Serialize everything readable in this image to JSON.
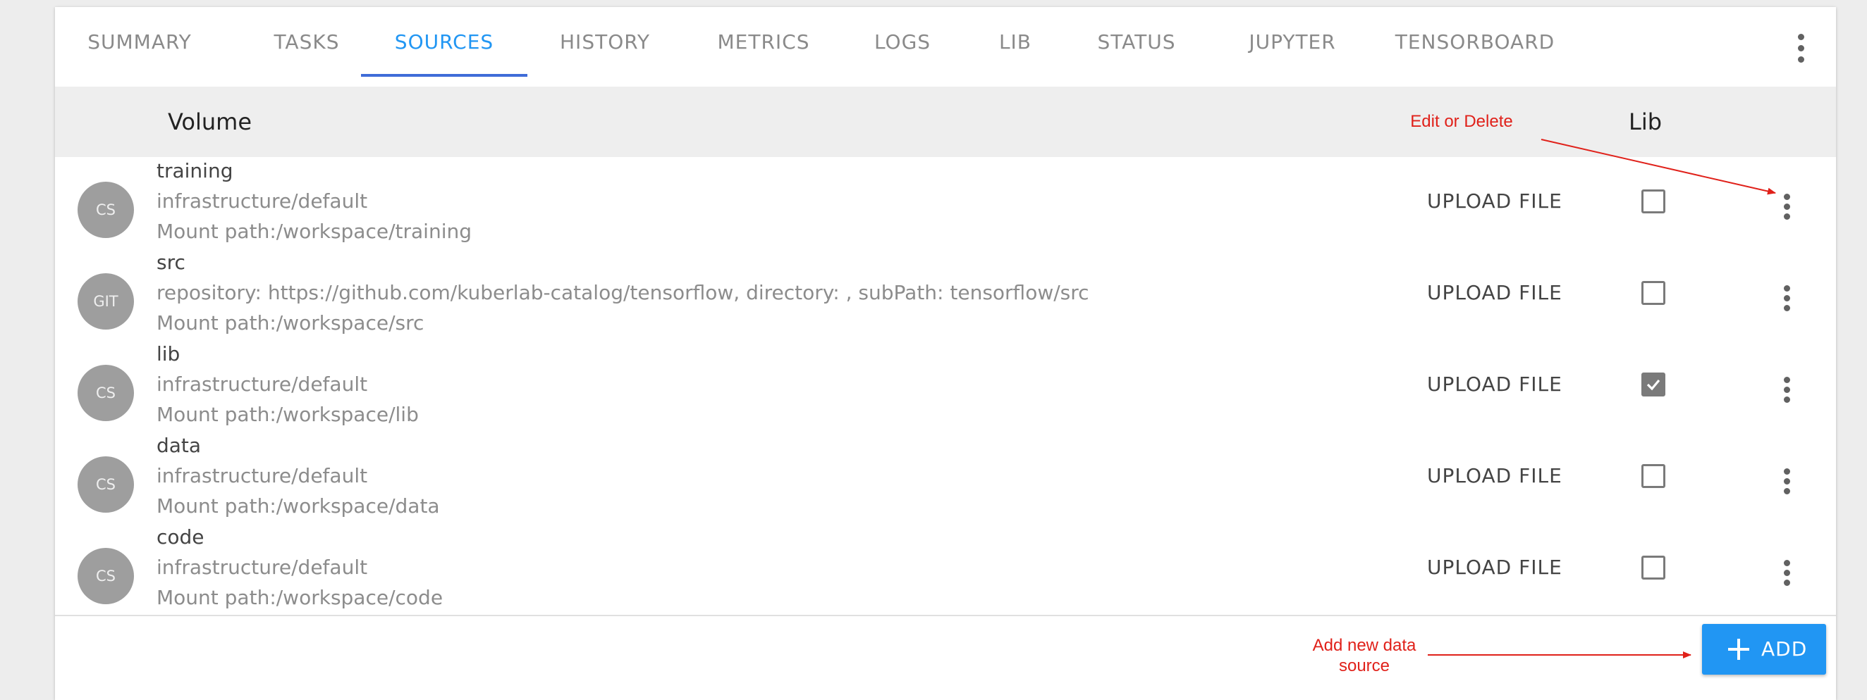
{
  "tabs": [
    {
      "label": "SUMMARY"
    },
    {
      "label": "TASKS"
    },
    {
      "label": "SOURCES"
    },
    {
      "label": "HISTORY"
    },
    {
      "label": "METRICS"
    },
    {
      "label": "LOGS"
    },
    {
      "label": "LIB"
    },
    {
      "label": "STATUS"
    },
    {
      "label": "JUPYTER"
    },
    {
      "label": "TENSORBOARD"
    }
  ],
  "active_tab": "SOURCES",
  "accent_color": "#2196f3",
  "table": {
    "header_volume": "Volume",
    "header_lib": "Lib"
  },
  "rows": [
    {
      "avatar": "CS",
      "name": "training",
      "line1": "infrastructure/default",
      "line2": "Mount path:/workspace/training",
      "upload": "UPLOAD FILE",
      "lib_checked": false
    },
    {
      "avatar": "GIT",
      "name": "src",
      "line1": "repository: https://github.com/kuberlab-catalog/tensorflow, directory: , subPath: tensorflow/src",
      "line2": "Mount path:/workspace/src",
      "upload": "UPLOAD FILE",
      "lib_checked": false
    },
    {
      "avatar": "CS",
      "name": "lib",
      "line1": "infrastructure/default",
      "line2": "Mount path:/workspace/lib",
      "upload": "UPLOAD FILE",
      "lib_checked": true
    },
    {
      "avatar": "CS",
      "name": "data",
      "line1": "infrastructure/default",
      "line2": "Mount path:/workspace/data",
      "upload": "UPLOAD FILE",
      "lib_checked": false
    },
    {
      "avatar": "CS",
      "name": "code",
      "line1": "infrastructure/default",
      "line2": "Mount path:/workspace/code",
      "upload": "UPLOAD FILE",
      "lib_checked": false
    }
  ],
  "add_button": {
    "label": "ADD",
    "icon": "plus-icon"
  },
  "annotations": {
    "edit_or_delete": "Edit or Delete",
    "add_new_line1": "Add new data",
    "add_new_line2": "source"
  },
  "annotation_color": "#e0211a"
}
